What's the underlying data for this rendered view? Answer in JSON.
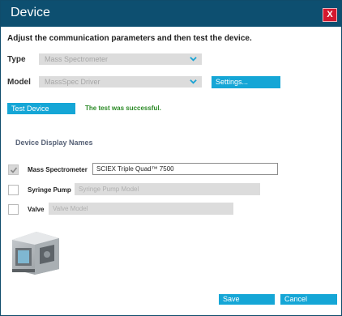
{
  "window": {
    "title": "Device",
    "close_label": "X"
  },
  "instruction": "Adjust the communication parameters and then test the device.",
  "type": {
    "label": "Type",
    "value": "Mass Spectrometer"
  },
  "model": {
    "label": "Model",
    "value": "MassSpec Driver",
    "settings_label": "Settings..."
  },
  "test": {
    "button_label": "Test Device",
    "status": "The test was successful.",
    "status_color": "#2b8a26"
  },
  "display_names": {
    "heading": "Device Display Names",
    "rows": [
      {
        "label": "Mass Spectrometer",
        "checked": true,
        "value": "SCIEX Triple Quad™ 7500",
        "placeholder": "",
        "enabled": true
      },
      {
        "label": "Syringe Pump",
        "checked": false,
        "value": "",
        "placeholder": "Syringe Pump Model",
        "enabled": false
      },
      {
        "label": "Valve",
        "checked": false,
        "value": "",
        "placeholder": "Valve Model",
        "enabled": false
      }
    ]
  },
  "footer": {
    "save_label": "Save",
    "cancel_label": "Cancel"
  },
  "colors": {
    "title_bar": "#0d4f70",
    "accent": "#15a6d6",
    "close": "#d4182e"
  },
  "icons": {
    "dropdown": "chevron-down-icon",
    "check": "checkmark-icon",
    "device": "mass-spectrometer-image"
  }
}
